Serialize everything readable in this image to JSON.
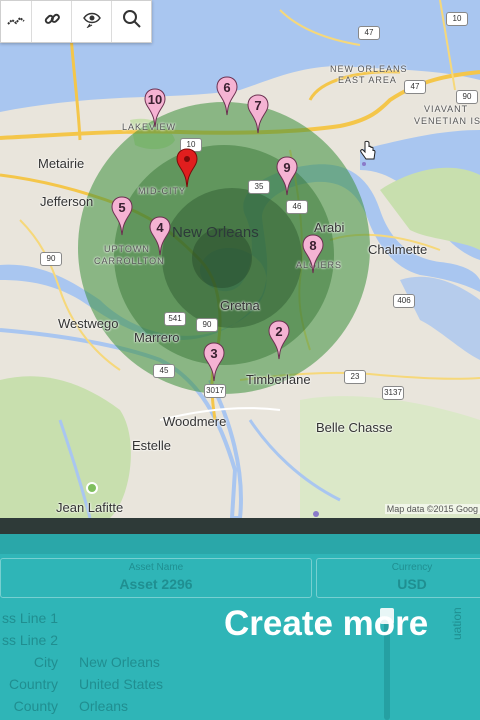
{
  "toolbar": {
    "tools": [
      {
        "name": "polyline-tool",
        "icon": "polyline-icon"
      },
      {
        "name": "link-tool",
        "icon": "link-icon"
      },
      {
        "name": "view-tool",
        "icon": "eye-icon"
      },
      {
        "name": "search-tool",
        "icon": "search-icon"
      }
    ]
  },
  "map": {
    "labels": {
      "metairie": "Metairie",
      "jefferson": "Jefferson",
      "lakeview": "LAKEVIEW",
      "mid_city": "MID-CITY",
      "uptown": "UPTOWN",
      "carrollton": "CARROLLTON",
      "new_orleans": "New Orleans",
      "arabi": "Arabi",
      "chalmette": "Chalmette",
      "westwego": "Westwego",
      "marrero": "Marrero",
      "gretna": "Gretna",
      "algiers": "ALGIERS",
      "timberlane": "Timberlane",
      "woodmere": "Woodmere",
      "estelle": "Estelle",
      "belle_chasse": "Belle Chasse",
      "jean_lafitte": "Jean Lafitte",
      "new_orleans_east": "NEW ORLEANS",
      "east_area": "EAST AREA",
      "viavant": "VIAVANT",
      "venetian": "VENETIAN ISLE"
    },
    "shields": [
      "47",
      "10",
      "10",
      "90",
      "35",
      "46",
      "406",
      "541",
      "90",
      "45",
      "3017",
      "3137",
      "23",
      "47",
      "90"
    ],
    "pins": [
      "10",
      "6",
      "7",
      "",
      "9",
      "5",
      "4",
      "8",
      "2",
      "3"
    ],
    "attribution": "Map data ©2015 Goog",
    "colors": {
      "water": "#a9c6f0",
      "park": "#c8dfae",
      "pin": "#f5b3d3",
      "selected_pin": "#e01e1e",
      "radius": "#3c8f3c"
    }
  },
  "form": {
    "asset_name_label": "Asset Name",
    "asset_name_value": "Asset 2296",
    "currency_label": "Currency",
    "currency_value": "USD",
    "address_line1_label": "ss Line 1",
    "address_line2_label": "ss Line 2",
    "city_label": "City",
    "city_value": "New Orleans",
    "country_label": "Country",
    "country_value": "United States",
    "county_label": "County",
    "county_value": "Orleans",
    "side_label": "uation"
  },
  "headline": "Create more"
}
